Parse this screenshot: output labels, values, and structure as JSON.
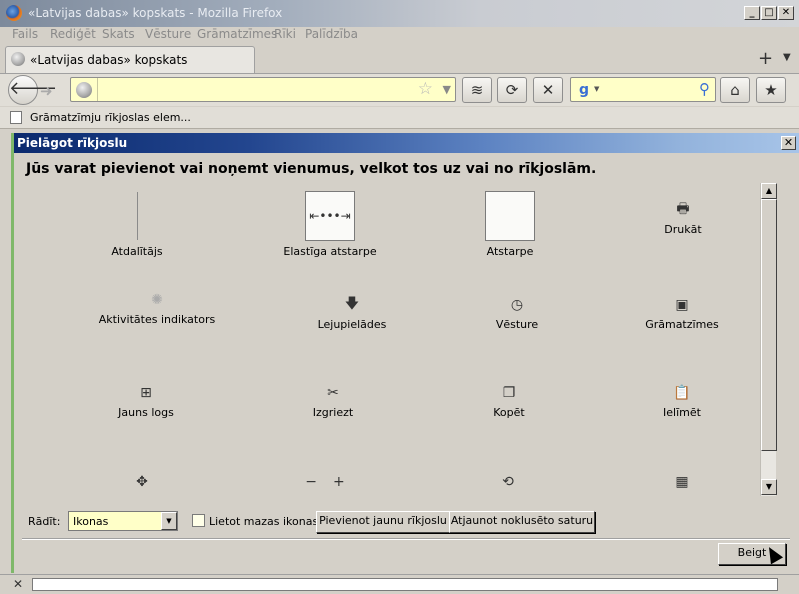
{
  "window": {
    "title": "«Latvijas dabas» kopskats - Mozilla Firefox"
  },
  "menu": [
    "Fails",
    "Rediģēt",
    "Skats",
    "Vēsture",
    "Grāmatzīmes",
    "Rīki",
    "Palīdzība"
  ],
  "tab": {
    "label": "«Latvijas dabas» kopskats"
  },
  "urlbar": {
    "value": ""
  },
  "bookmarks_toolbar": {
    "item_label": "Grāmatzīmju rīkjoslas elem..."
  },
  "dialog": {
    "title": "Pielāgot rīkjoslu",
    "instruction": "Jūs varat pievienot vai noņemt vienumus, velkot tos uz vai no rīkjoslām.",
    "palette": [
      {
        "label": "Atdalītājs",
        "icon": "separator-icon"
      },
      {
        "label": "Elastīga atstarpe",
        "icon": "flexible-space-icon"
      },
      {
        "label": "Atstarpe",
        "icon": "space-icon"
      },
      {
        "label": "Drukāt",
        "icon": "print-icon"
      },
      {
        "label": "Aktivitātes indikators",
        "icon": "throbber-icon"
      },
      {
        "label": "Lejupielādes",
        "icon": "download-icon"
      },
      {
        "label": "Vēsture",
        "icon": "history-icon"
      },
      {
        "label": "Grāmatzīmes",
        "icon": "bookmarks-icon"
      },
      {
        "label": "Jauns logs",
        "icon": "new-window-icon"
      },
      {
        "label": "Izgriezt",
        "icon": "cut-icon"
      },
      {
        "label": "Kopēt",
        "icon": "copy-icon"
      },
      {
        "label": "Ielīmēt",
        "icon": "paste-icon"
      },
      {
        "label": "",
        "icon": "fullscreen-icon"
      },
      {
        "label": "",
        "icon": "zoom-controls-icon"
      },
      {
        "label": "",
        "icon": "sync-icon"
      },
      {
        "label": "",
        "icon": "tab-groups-icon"
      }
    ],
    "show_label": "Rādīt:",
    "show_value": "Ikonas",
    "small_icons_label": "Lietot mazas ikonas",
    "small_icons_checked": false,
    "add_toolbar_button": "Pievienot jaunu rīkjoslu",
    "restore_defaults_button": "Atjaunot noklusēto saturu",
    "done_button": "Beigt"
  },
  "colors": {
    "dialog_title_start": "#0b2a6e",
    "dialog_title_end": "#a7c4e8",
    "urlbar_bg": "#ffffc8",
    "left_accent": "#7fb86a"
  }
}
